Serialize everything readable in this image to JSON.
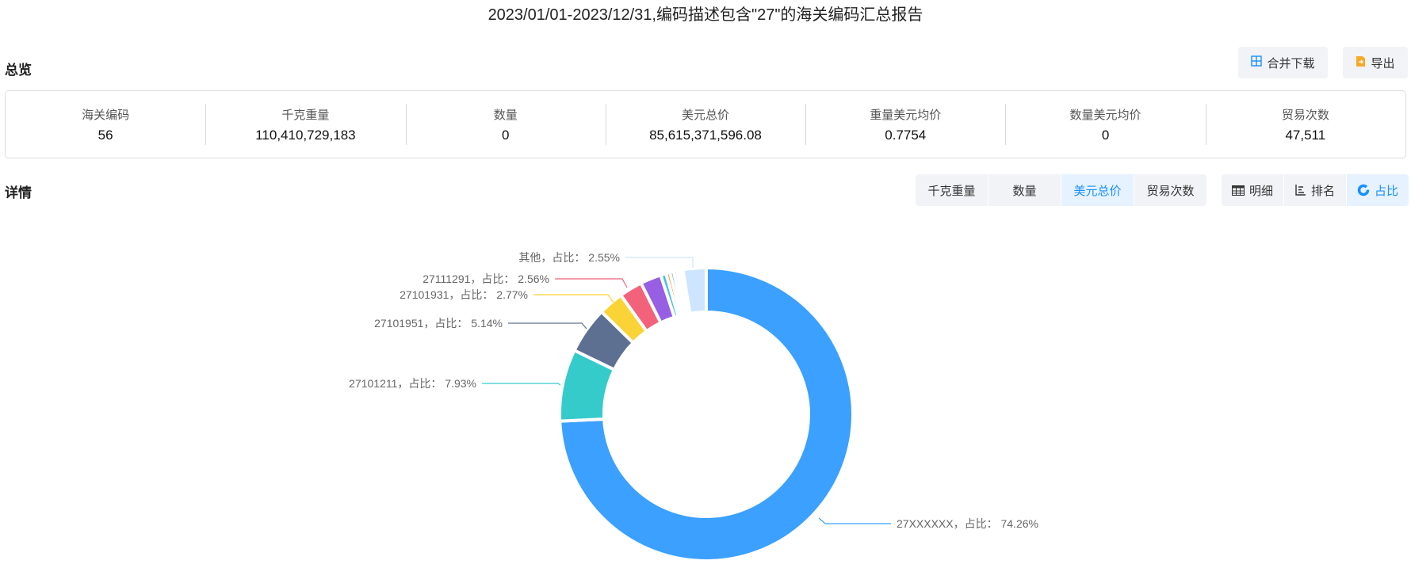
{
  "header": {
    "title": "2023/01/01-2023/12/31,编码描述包含\"27\"的海关编码汇总报告"
  },
  "overview": {
    "title": "总览",
    "merge_download_label": "合并下载",
    "export_label": "导出",
    "stats": [
      {
        "label": "海关编码",
        "value": "56"
      },
      {
        "label": "千克重量",
        "value": "110,410,729,183"
      },
      {
        "label": "数量",
        "value": "0"
      },
      {
        "label": "美元总价",
        "value": "85,615,371,596.08"
      },
      {
        "label": "重量美元均价",
        "value": "0.7754"
      },
      {
        "label": "数量美元均价",
        "value": "0"
      },
      {
        "label": "贸易次数",
        "value": "47,511"
      }
    ]
  },
  "details": {
    "title": "详情",
    "metric_tabs": [
      {
        "label": "千克重量",
        "active": false
      },
      {
        "label": "数量",
        "active": false
      },
      {
        "label": "美元总价",
        "active": true
      },
      {
        "label": "贸易次数",
        "active": false
      }
    ],
    "view_tabs": [
      {
        "label": "明细",
        "icon": "table-icon",
        "active": false
      },
      {
        "label": "排名",
        "icon": "ranking-icon",
        "active": false
      },
      {
        "label": "占比",
        "icon": "donut-icon",
        "active": true
      }
    ]
  },
  "chart_data": {
    "type": "pie",
    "variant": "donut",
    "value_unit": "%",
    "slices": [
      {
        "name": "27XXXXXX",
        "value": 74.26,
        "label": "27XXXXXX，占比： 74.26%",
        "color": "#3ba0ff"
      },
      {
        "name": "27101211",
        "value": 7.93,
        "label": "27101211，占比： 7.93%",
        "color": "#36cbcb"
      },
      {
        "name": "27101951",
        "value": 5.14,
        "label": "27101951，占比： 5.14%",
        "color": "#5d7092"
      },
      {
        "name": "27101931",
        "value": 2.77,
        "label": "27101931，占比： 2.77%",
        "color": "#fad337"
      },
      {
        "name": "27111291",
        "value": 2.56,
        "label": "27111291，占比： 2.56%",
        "color": "#f2637b"
      },
      {
        "name": "",
        "value": 2.3,
        "label": "",
        "color": "#975fe4"
      },
      {
        "name": "",
        "value": 0.6,
        "label": "",
        "color": "#45c2e0"
      },
      {
        "name": "",
        "value": 0.45,
        "label": "",
        "color": "#ff9845"
      },
      {
        "name": "",
        "value": 0.4,
        "label": "",
        "color": "#1e9493"
      },
      {
        "name": "",
        "value": 0.38,
        "label": "",
        "color": "#ff99c3"
      },
      {
        "name": "",
        "value": 0.35,
        "label": "",
        "color": "#5c8ef5"
      },
      {
        "name": "",
        "value": 0.31,
        "label": "",
        "color": "#c9e6a7"
      },
      {
        "name": "其他",
        "value": 2.55,
        "label": "其他，占比： 2.55%",
        "color": "#cde5ff"
      }
    ]
  }
}
